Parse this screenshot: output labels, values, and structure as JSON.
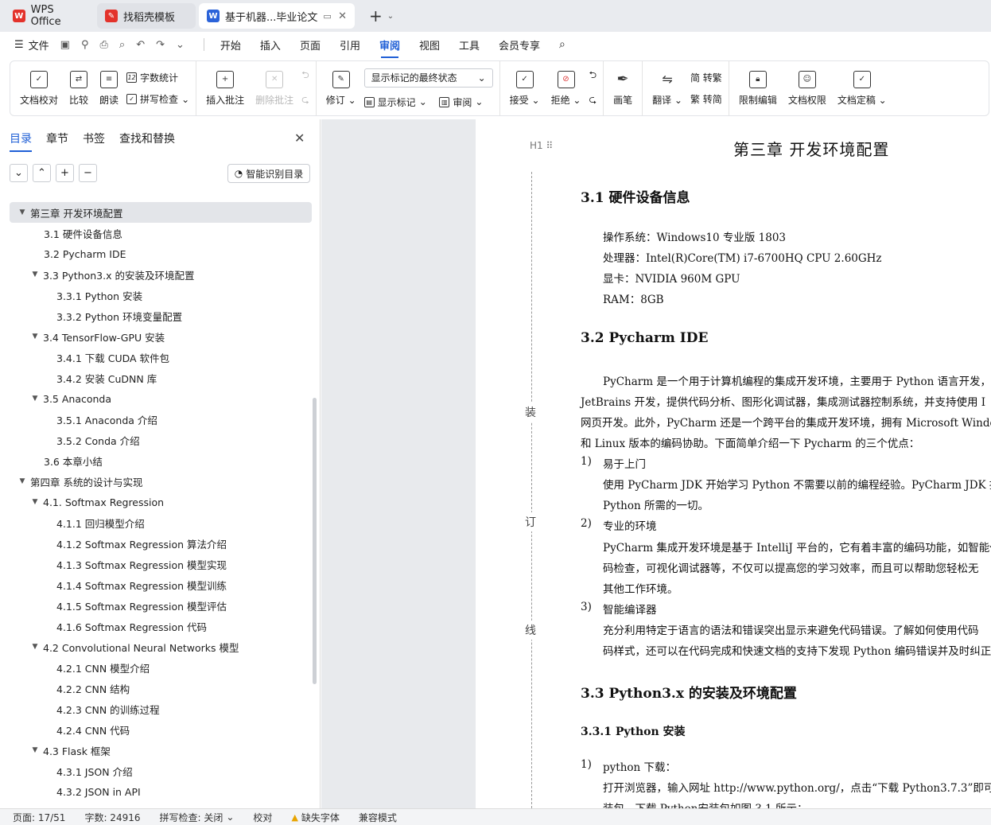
{
  "tabs": [
    {
      "label": "WPS Office",
      "icon": "wps-logo-icon",
      "color": "#e3322b"
    },
    {
      "label": "找稻壳模板",
      "icon": "docer-logo-icon",
      "color": "#e3322b"
    },
    {
      "label": "基于机器...毕业论文",
      "icon": "writer-logo-icon",
      "color": "#2b63d9"
    }
  ],
  "menu": {
    "file": "文件",
    "items": [
      "开始",
      "插入",
      "页面",
      "引用",
      "审阅",
      "视图",
      "工具",
      "会员专享"
    ],
    "active": "审阅"
  },
  "ribbon": {
    "doc_check": "文档校对",
    "compare": "比较",
    "read_aloud": "朗读",
    "word_count": "字数统计",
    "spell_check": "拼写检查",
    "insert_comment": "插入批注",
    "delete_comment": "删除批注",
    "track_changes": "修订",
    "markup_state": "显示标记的最终状态",
    "show_markup": "显示标记",
    "review_pane": "审阅",
    "accept": "接受",
    "reject": "拒绝",
    "pen": "画笔",
    "translate": "翻译",
    "to_traditional": "简 转繁",
    "to_simplified": "繁 转简",
    "restrict_edit": "限制编辑",
    "doc_permission": "文档权限",
    "doc_finalize": "文档定稿"
  },
  "sidebar": {
    "tabs": [
      "目录",
      "章节",
      "书签",
      "查找和替换"
    ],
    "active_tab": "目录",
    "smart_toc": "智能识别目录",
    "toc": [
      {
        "level": 1,
        "caret": "▼",
        "text": "第三章  开发环境配置",
        "selected": true
      },
      {
        "level": 2,
        "caret": "",
        "text": "3.1  硬件设备信息"
      },
      {
        "level": 2,
        "caret": "",
        "text": "3.2 Pycharm  IDE"
      },
      {
        "level": 2,
        "caret": "▼",
        "text": "3.3 Python3.x 的安装及环境配置"
      },
      {
        "level": 3,
        "caret": "",
        "text": "3.3.1 Python 安装"
      },
      {
        "level": 3,
        "caret": "",
        "text": "3.3.2 Python 环境变量配置"
      },
      {
        "level": 2,
        "caret": "▼",
        "text": "3.4 TensorFlow-GPU 安装"
      },
      {
        "level": 3,
        "caret": "",
        "text": "3.4.1 下载 CUDA 软件包"
      },
      {
        "level": 3,
        "caret": "",
        "text": "3.4.2 安装 CuDNN 库"
      },
      {
        "level": 2,
        "caret": "▼",
        "text": "3.5 Anaconda"
      },
      {
        "level": 3,
        "caret": "",
        "text": "3.5.1 Anaconda 介绍"
      },
      {
        "level": 3,
        "caret": "",
        "text": "3.5.2 Conda 介绍"
      },
      {
        "level": 2,
        "caret": "",
        "text": "3.6  本章小结"
      },
      {
        "level": 1,
        "caret": "▼",
        "text": "第四章  系统的设计与实现"
      },
      {
        "level": 2,
        "caret": "▼",
        "text": "4.1. Softmax Regression"
      },
      {
        "level": 3,
        "caret": "",
        "text": "4.1.1 回归模型介绍"
      },
      {
        "level": 3,
        "caret": "",
        "text": "4.1.2 Softmax Regression 算法介绍"
      },
      {
        "level": 3,
        "caret": "",
        "text": "4.1.3 Softmax Regression 模型实现"
      },
      {
        "level": 3,
        "caret": "",
        "text": "4.1.4 Softmax Regression 模型训练"
      },
      {
        "level": 3,
        "caret": "",
        "text": "4.1.5 Softmax Regression 模型评估"
      },
      {
        "level": 3,
        "caret": "",
        "text": "4.1.6    Softmax Regression 代码"
      },
      {
        "level": 2,
        "caret": "▼",
        "text": "4.2 Convolutional Neural Networks 模型"
      },
      {
        "level": 3,
        "caret": "",
        "text": "4.2.1 CNN 模型介绍"
      },
      {
        "level": 3,
        "caret": "",
        "text": "4.2.2 CNN 结构"
      },
      {
        "level": 3,
        "caret": "",
        "text": "4.2.3 CNN 的训练过程"
      },
      {
        "level": 3,
        "caret": "",
        "text": "4.2.4 CNN 代码"
      },
      {
        "level": 2,
        "caret": "▼",
        "text": "4.3 Flask 框架"
      },
      {
        "level": 3,
        "caret": "",
        "text": "4.3.1 JSON 介绍"
      },
      {
        "level": 3,
        "caret": "",
        "text": "4.3.2 JSON in API"
      }
    ]
  },
  "doc": {
    "heading_marker": "H1",
    "binding": [
      "装",
      "订",
      "线"
    ],
    "chapter_title": "第三章  开发环境配置",
    "s31": "3.1  硬件设备信息",
    "hw": [
      "操作系统：Windows10 专业版 1803",
      "处理器：Intel(R)Core(TM) i7-6700HQ CPU 2.60GHz",
      "显卡：NVIDIA 960M GPU",
      "RAM：8GB"
    ],
    "s32": "3.2 Pycharm IDE",
    "pycharm_para": [
      "PyCharm 是一个用于计算机编程的集成开发环境，主要用于 Python 语言开发，",
      "JetBrains 开发，提供代码分析、图形化调试器，集成测试器控制系统，并支持使用 I",
      "网页开发。此外，PyCharm 还是一个跨平台的集成开发环境，拥有 Microsoft Windo",
      "和 Linux 版本的编码协助。下面简单介绍一下 Pycharm 的三个优点："
    ],
    "items": [
      {
        "num": "1)",
        "title": "易于上门",
        "lines": [
          "使用 PyCharm JDK 开始学习 Python 不需要以前的编程经验。PyCharm JDK 提供",
          "Python 所需的一切。"
        ]
      },
      {
        "num": "2)",
        "title": "专业的环境",
        "lines": [
          "PyCharm 集成开发环境是基于 IntelliJ 平台的，它有着丰富的编码功能，如智能代",
          "码检查，可视化调试器等，不仅可以提高您的学习效率，而且可以帮助您轻松无",
          "其他工作环境。"
        ]
      },
      {
        "num": "3)",
        "title": "智能编译器",
        "lines": [
          "充分利用特定于语言的语法和错误突出显示来避免代码错误。了解如何使用代码",
          "码样式，还可以在代码完成和快速文档的支持下发现 Python 编码错误并及时纠正"
        ]
      }
    ],
    "s33": "3.3 Python3.x 的安装及环境配置",
    "s331": "3.3.1 Python 安装",
    "dl_num": "1)",
    "dl_title": "python 下载：",
    "dl_lines": [
      "打开浏览器，输入网址 http://www.python.org/，点击“下载 Python3.7.3”即可下载",
      "装包。下载 Python安装包如图 3.1 所示："
    ]
  },
  "status": {
    "page": "页面: 17/51",
    "words": "字数: 24916",
    "spell": "拼写检查: 关闭",
    "proof": "校对",
    "missing_font": "缺失字体",
    "compat": "兼容模式"
  }
}
